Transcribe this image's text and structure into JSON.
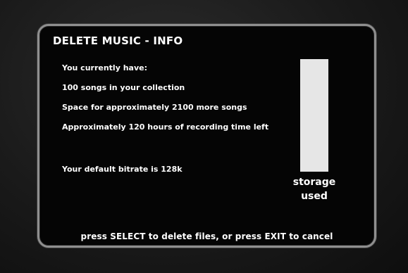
{
  "screen": {
    "title": "DELETE MUSIC - INFO",
    "info_lines": [
      "You currently have:",
      "100 songs in your collection",
      "Space for approximately 2100 more songs",
      "Approximately 120 hours of recording time left"
    ],
    "bitrate_text": "Your default bitrate is 128k",
    "storage": {
      "label_line1": "storage",
      "label_line2": "used",
      "used_fraction": 1.0,
      "bar_color": "#e6e6e6"
    },
    "footer_prompt": "press SELECT to delete files, or press EXIT to cancel"
  }
}
